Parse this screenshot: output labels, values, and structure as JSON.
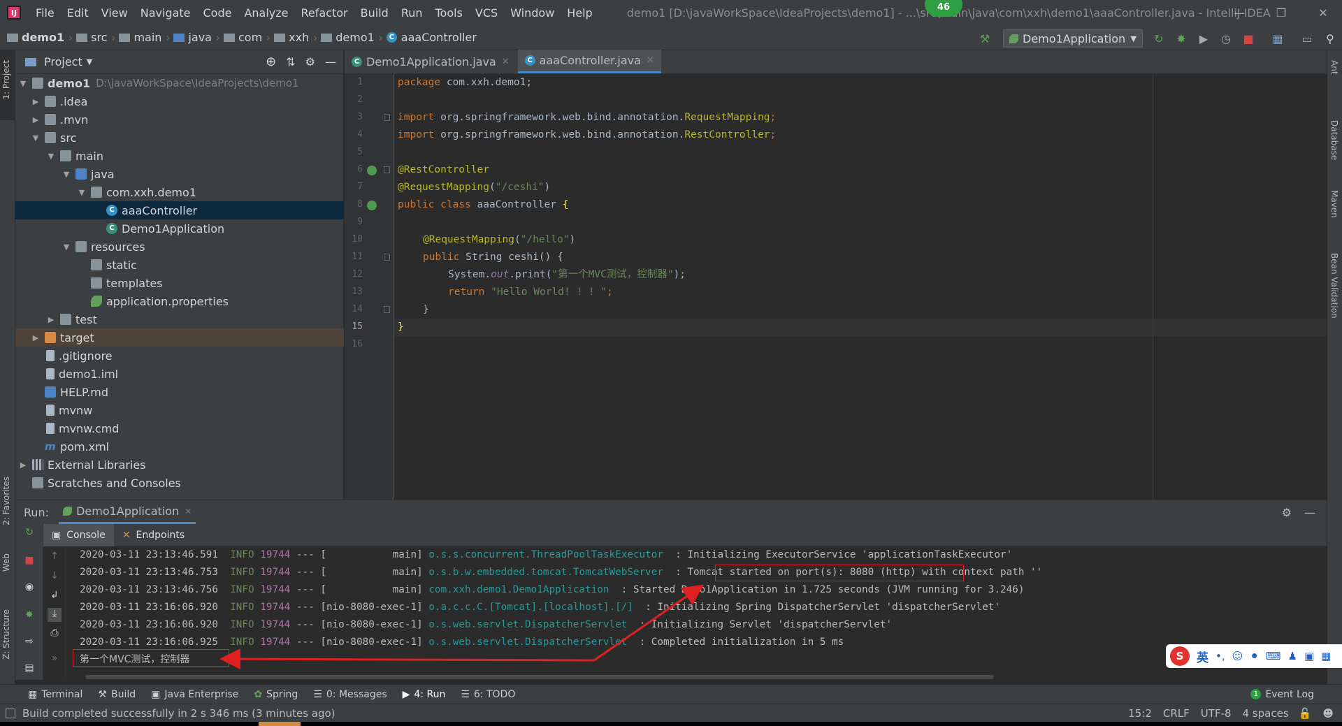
{
  "menubar": {
    "items": [
      "File",
      "Edit",
      "View",
      "Navigate",
      "Code",
      "Analyze",
      "Refactor",
      "Build",
      "Run",
      "Tools",
      "VCS",
      "Window",
      "Help"
    ],
    "window_title": "demo1 [D:\\javaWorkSpace\\IdeaProjects\\demo1] - ...\\src\\main\\java\\com\\xxh\\demo1\\aaaController.java - IntelliJ IDEA",
    "badge": "46"
  },
  "breadcrumb": [
    "demo1",
    "src",
    "main",
    "java",
    "com",
    "xxh",
    "demo1",
    "aaaController"
  ],
  "run_config": "Demo1Application",
  "left_strip": {
    "project": "1: Project",
    "favorites": "2: Favorites",
    "web": "Web",
    "structure": "Z: Structure"
  },
  "right_strip": [
    "Ant",
    "Database",
    "Maven",
    "Bean Validation"
  ],
  "project_panel": {
    "title": "Project",
    "tree": [
      {
        "label": "demo1",
        "hint": "D:\\javaWorkSpace\\IdeaProjects\\demo1"
      },
      {
        "label": ".idea"
      },
      {
        "label": ".mvn"
      },
      {
        "label": "src"
      },
      {
        "label": "main"
      },
      {
        "label": "java"
      },
      {
        "label": "com.xxh.demo1"
      },
      {
        "label": "aaaController"
      },
      {
        "label": "Demo1Application"
      },
      {
        "label": "resources"
      },
      {
        "label": "static"
      },
      {
        "label": "templates"
      },
      {
        "label": "application.properties"
      },
      {
        "label": "test"
      },
      {
        "label": "target"
      },
      {
        "label": ".gitignore"
      },
      {
        "label": "demo1.iml"
      },
      {
        "label": "HELP.md"
      },
      {
        "label": "mvnw"
      },
      {
        "label": "mvnw.cmd"
      },
      {
        "label": "pom.xml"
      },
      {
        "label": "External Libraries"
      },
      {
        "label": "Scratches and Consoles"
      }
    ]
  },
  "editor_tabs": [
    "Demo1Application.java",
    "aaaController.java"
  ],
  "code": {
    "line_numbers": [
      "1",
      "2",
      "3",
      "4",
      "5",
      "6",
      "7",
      "8",
      "9",
      "10",
      "11",
      "12",
      "13",
      "14",
      "15",
      "16"
    ],
    "l1_kw": "package",
    "l1_rest": " com.xxh.demo1;",
    "l3_kw": "import",
    "l3_rest": " org.springframework.web.bind.annotation.",
    "l3_ann": "RequestMapping",
    "l3_end": ";",
    "l4_kw": "import",
    "l4_rest": " org.springframework.web.bind.annotation.",
    "l4_ann": "RestController",
    "l4_end": ";",
    "l6": "@RestController",
    "l7_ann": "@RequestMapping",
    "l7_p1": "(",
    "l7_str": "\"/ceshi\"",
    "l7_p2": ")",
    "l8_kw": "public class",
    "l8_rest": " aaaController ",
    "l8_brace": "{",
    "l10_ann": "@RequestMapping",
    "l10_p1": "(",
    "l10_str": "\"/hello\"",
    "l10_p2": ")",
    "l11_kw": "public",
    "l11_rest": " String ceshi() {",
    "l12_a": "System.",
    "l12_fld": "out",
    "l12_b": ".print(",
    "l12_str": "\"第一个MVC测试，控制器\"",
    "l12_c": ");",
    "l13_kw": "return",
    "l13_str": " \"Hello World! ! ! \"",
    "l13_end": ";",
    "l14": "}",
    "l15": "}"
  },
  "run_panel": {
    "label": "Run:",
    "tab": "Demo1Application",
    "subtabs": [
      "Console",
      "Endpoints"
    ],
    "log": [
      {
        "ts": "2020-03-11 23:13:46.591",
        "level": "INFO",
        "pid": "19744",
        "sep": "--- [",
        "thread": "           main]",
        "cls": "o.s.s.concurrent.ThreadPoolTaskExecutor",
        "msg": ": Initializing ExecutorService 'applicationTaskExecutor'"
      },
      {
        "ts": "2020-03-11 23:13:46.753",
        "level": "INFO",
        "pid": "19744",
        "sep": "--- [",
        "thread": "           main]",
        "cls": "o.s.b.w.embedded.tomcat.TomcatWebServer",
        "msg": ": Tomcat started on port(s): 8080 (http) with context path ''"
      },
      {
        "ts": "2020-03-11 23:13:46.756",
        "level": "INFO",
        "pid": "19744",
        "sep": "--- [",
        "thread": "           main]",
        "cls": "com.xxh.demo1.Demo1Application",
        "msg": ": Started Demo1Application in 1.725 seconds (JVM running for 3.246)"
      },
      {
        "ts": "2020-03-11 23:16:06.920",
        "level": "INFO",
        "pid": "19744",
        "sep": "--- [",
        "thread": "nio-8080-exec-1]",
        "cls": "o.a.c.c.C.[Tomcat].[localhost].[/]",
        "msg": ": Initializing Spring DispatcherServlet 'dispatcherServlet'"
      },
      {
        "ts": "2020-03-11 23:16:06.920",
        "level": "INFO",
        "pid": "19744",
        "sep": "--- [",
        "thread": "nio-8080-exec-1]",
        "cls": "o.s.web.servlet.DispatcherServlet",
        "msg": ": Initializing Servlet 'dispatcherServlet'"
      },
      {
        "ts": "2020-03-11 23:16:06.925",
        "level": "INFO",
        "pid": "19744",
        "sep": "--- [",
        "thread": "nio-8080-exec-1]",
        "cls": "o.s.web.servlet.DispatcherServlet",
        "msg": ": Completed initialization in 5 ms"
      }
    ],
    "output": "第一个MVC测试，控制器"
  },
  "bottom_tools": [
    "Terminal",
    "Build",
    "Java Enterprise",
    "Spring",
    "0: Messages",
    "4: Run",
    "6: TODO"
  ],
  "event_log": "Event Log",
  "status": {
    "message": "Build completed successfully in 2 s 346 ms (3 minutes ago)",
    "position": "15:2",
    "line_sep": "CRLF",
    "encoding": "UTF-8",
    "indent": "4 spaces"
  },
  "ime": {
    "lang": "英"
  },
  "colors": {
    "accent": "#4a88c7",
    "annotation_red": "#e02020",
    "selection": "#0d293e"
  }
}
